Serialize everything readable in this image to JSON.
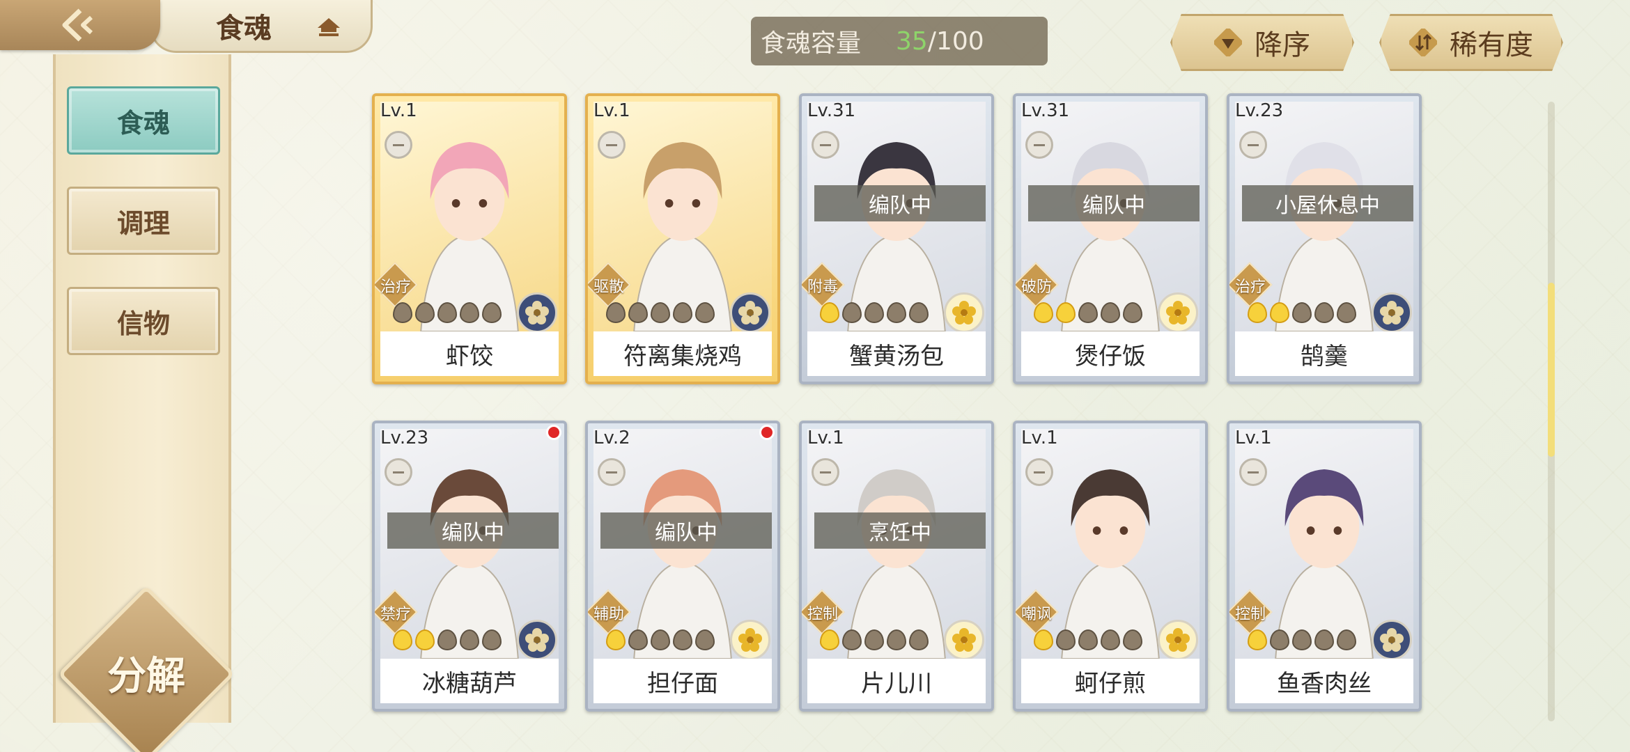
{
  "header": {
    "title": "食魂",
    "back_icon": "back-arrow-icon",
    "hat_icon": "pavilion-hat-icon"
  },
  "sidebar": {
    "items": [
      {
        "label": "食魂",
        "active": true
      },
      {
        "label": "调理",
        "active": false
      },
      {
        "label": "信物",
        "active": false
      }
    ],
    "decompose_label": "分解"
  },
  "capacity": {
    "label": "食魂容量",
    "current": "35",
    "total": "/100"
  },
  "sort": {
    "order_label": "降序",
    "order_icon": "triangle-down-icon",
    "rarity_label": "稀有度",
    "rarity_icon": "sort-toggle-icon"
  },
  "cards": [
    {
      "level": "Lv.1",
      "name": "虾饺",
      "role": "治疗",
      "status": "",
      "stars": 0,
      "frame": "gold",
      "element": "blue-flower",
      "dot": false
    },
    {
      "level": "Lv.1",
      "name": "符离集烧鸡",
      "role": "驱散",
      "status": "",
      "stars": 0,
      "frame": "gold",
      "element": "blue-flower",
      "dot": false
    },
    {
      "level": "Lv.31",
      "name": "蟹黄汤包",
      "role": "附毒",
      "status": "编队中",
      "stars": 1,
      "frame": "silver",
      "element": "gold-flower",
      "dot": false
    },
    {
      "level": "Lv.31",
      "name": "煲仔饭",
      "role": "破防",
      "status": "编队中",
      "stars": 2,
      "frame": "silver",
      "element": "gold-flower",
      "dot": false
    },
    {
      "level": "Lv.23",
      "name": "鹄羹",
      "role": "治疗",
      "status": "小屋休息中",
      "stars": 2,
      "frame": "silver",
      "element": "blue-flower",
      "dot": false
    },
    {
      "level": "Lv.23",
      "name": "冰糖葫芦",
      "role": "禁疗",
      "status": "编队中",
      "stars": 2,
      "frame": "silver",
      "element": "blue-flower",
      "dot": true
    },
    {
      "level": "Lv.2",
      "name": "担仔面",
      "role": "辅助",
      "status": "编队中",
      "stars": 1,
      "frame": "silver",
      "element": "gold-flower",
      "dot": true
    },
    {
      "level": "Lv.1",
      "name": "片儿川",
      "role": "控制",
      "status": "烹饪中",
      "stars": 1,
      "frame": "silver",
      "element": "gold-flower",
      "dot": false
    },
    {
      "level": "Lv.1",
      "name": "蚵仔煎",
      "role": "嘲讽",
      "status": "",
      "stars": 1,
      "frame": "silver",
      "element": "gold-flower",
      "dot": false
    },
    {
      "level": "Lv.1",
      "name": "鱼香肉丝",
      "role": "控制",
      "status": "",
      "stars": 1,
      "frame": "silver",
      "element": "blue-flower",
      "dot": false
    }
  ],
  "colors": {
    "gold_frame": "#e4b04e",
    "silver_frame": "#aab3c2",
    "capacity_current": "#8ed46a",
    "active_tab": "#8ccbc1",
    "badge_dot": "#e02626"
  }
}
